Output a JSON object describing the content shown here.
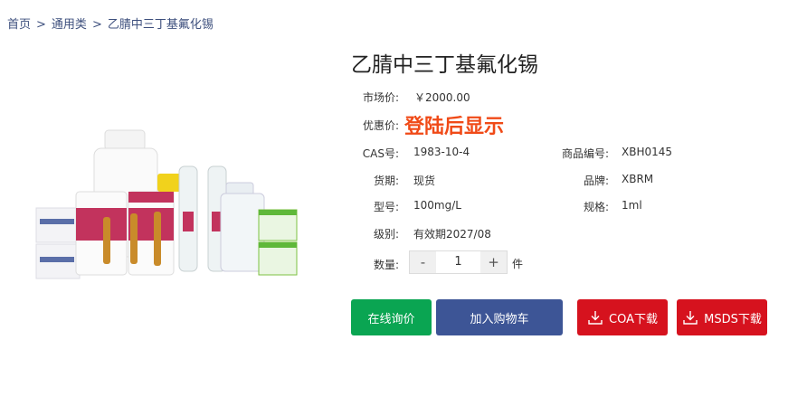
{
  "breadcrumb": {
    "home": "首页",
    "category": "通用类",
    "current": "乙腈中三丁基氟化锡",
    "separator": ">"
  },
  "product": {
    "title": "乙腈中三丁基氟化锡",
    "image_label": "product-photo",
    "market_price_label": "市场价:",
    "market_price": "￥2000.00",
    "promo_price_label": "优惠价:",
    "promo_price": "登陆后显示",
    "cas_label": "CAS号:",
    "cas": "1983-10-4",
    "item_no_label": "商品编号:",
    "item_no": "XBH0145",
    "stock_label": "货期:",
    "stock": "现货",
    "brand_label": "品牌:",
    "brand": "XBRM",
    "model_label": "型号:",
    "model": "100mg/L",
    "spec_label": "规格:",
    "spec": "1ml",
    "grade_label": "级别:",
    "grade": "有效期2027/08"
  },
  "quantity": {
    "label": "数量:",
    "minus": "-",
    "value": "1",
    "plus": "+",
    "unit": "件"
  },
  "actions": {
    "inquiry": "在线询价",
    "cart": "加入购物车",
    "coa": "COA下载",
    "msds": "MSDS下载"
  },
  "colors": {
    "inquiry": "#0aa552",
    "cart": "#3d5596",
    "download": "#d6121e",
    "promo": "#f04a17",
    "breadcrumb": "#3d4f7d"
  }
}
